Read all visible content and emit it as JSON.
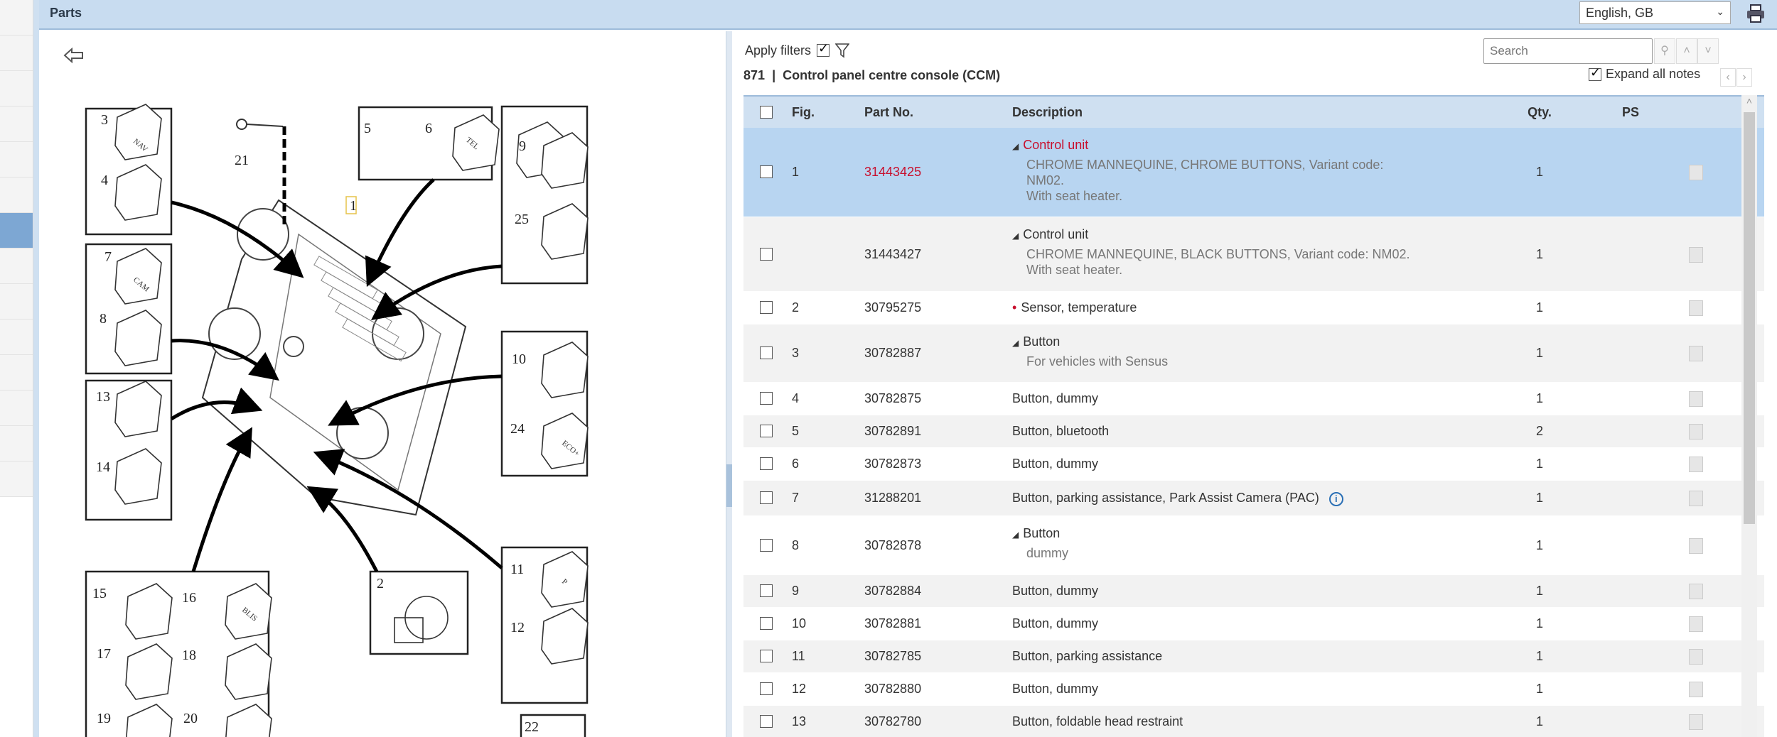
{
  "header": {
    "title": "Parts",
    "language": "English, GB"
  },
  "diagram": {
    "callouts": [
      "1",
      "2",
      "3",
      "4",
      "5",
      "6",
      "7",
      "8",
      "9",
      "10",
      "11",
      "12",
      "13",
      "14",
      "15",
      "16",
      "17",
      "18",
      "19",
      "20",
      "21",
      "22",
      "24",
      "25"
    ],
    "button_labels": {
      "nav": "NAV",
      "tel": "TEL",
      "cam": "CAM",
      "eco": "ECO+",
      "blis": "BLIS",
      "pa": "P"
    }
  },
  "filters": {
    "apply_label": "Apply filters",
    "apply_checked": true,
    "search_placeholder": "Search"
  },
  "breadcrumb": {
    "code": "871",
    "separator": "|",
    "title": "Control panel centre console (CCM)"
  },
  "expand_notes": {
    "label": "Expand all notes",
    "checked": true
  },
  "table": {
    "headers": {
      "fig": "Fig.",
      "part_no": "Part No.",
      "description": "Description",
      "qty": "Qty.",
      "ps": "PS"
    },
    "rows": [
      {
        "fig": "1",
        "part_no": "31443425",
        "marker": "triangle",
        "title": "Control unit",
        "notes": [
          "CHROME MANNEQUINE, CHROME BUTTONS, Variant code: NM02.",
          "With seat heater."
        ],
        "qty": "1",
        "selected": true
      },
      {
        "fig": "",
        "part_no": "31443427",
        "marker": "triangle",
        "title": "Control unit",
        "notes": [
          "CHROME MANNEQUINE, BLACK BUTTONS, Variant code: NM02.",
          "With seat heater."
        ],
        "qty": "1"
      },
      {
        "fig": "2",
        "part_no": "30795275",
        "marker": "dot",
        "title": "Sensor, temperature",
        "notes": [],
        "qty": "1"
      },
      {
        "fig": "3",
        "part_no": "30782887",
        "marker": "triangle",
        "title": "Button",
        "notes": [
          "For vehicles with Sensus"
        ],
        "qty": "1"
      },
      {
        "fig": "4",
        "part_no": "30782875",
        "marker": "",
        "title": "Button, dummy",
        "notes": [],
        "qty": "1"
      },
      {
        "fig": "5",
        "part_no": "30782891",
        "marker": "",
        "title": "Button, bluetooth",
        "notes": [],
        "qty": "2"
      },
      {
        "fig": "6",
        "part_no": "30782873",
        "marker": "",
        "title": "Button, dummy",
        "notes": [],
        "qty": "1"
      },
      {
        "fig": "7",
        "part_no": "31288201",
        "marker": "",
        "title": "Button, parking assistance, Park Assist Camera (PAC)",
        "notes": [],
        "qty": "1",
        "info": "i"
      },
      {
        "fig": "8",
        "part_no": "30782878",
        "marker": "triangle",
        "title": "Button",
        "notes": [
          "dummy"
        ],
        "qty": "1"
      },
      {
        "fig": "9",
        "part_no": "30782884",
        "marker": "",
        "title": "Button, dummy",
        "notes": [],
        "qty": "1"
      },
      {
        "fig": "10",
        "part_no": "30782881",
        "marker": "",
        "title": "Button, dummy",
        "notes": [],
        "qty": "1"
      },
      {
        "fig": "11",
        "part_no": "30782785",
        "marker": "",
        "title": "Button, parking assistance",
        "notes": [],
        "qty": "1"
      },
      {
        "fig": "12",
        "part_no": "30782880",
        "marker": "",
        "title": "Button, dummy",
        "notes": [],
        "qty": "1"
      },
      {
        "fig": "13",
        "part_no": "30782780",
        "marker": "",
        "title": "Button, foldable head restraint",
        "notes": [],
        "qty": "1"
      }
    ]
  },
  "colors": {
    "header_bg": "#c8dcf0",
    "selected_row": "#b8d5f1",
    "part_red": "#c8102e",
    "info_blue": "#2a6fb5"
  }
}
